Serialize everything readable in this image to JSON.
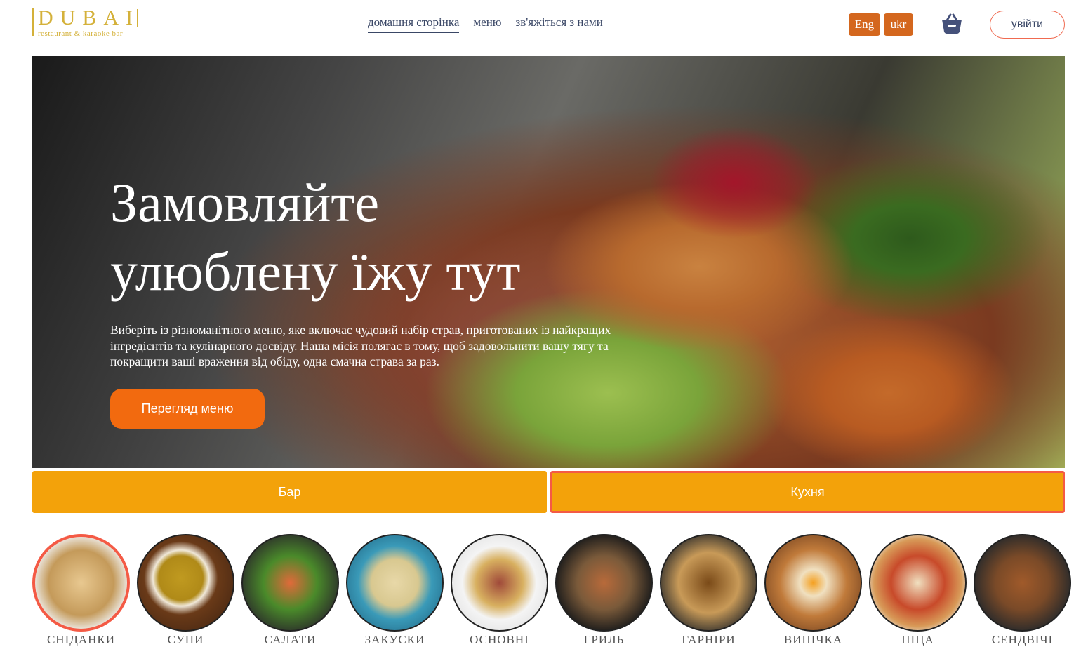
{
  "header": {
    "logo_title": "DUBAI",
    "logo_subtitle": "restaurant & karaoke bar",
    "nav": [
      "домашня сторінка",
      "меню",
      "зв'яжіться з нами"
    ],
    "lang": [
      "Eng",
      "ukr"
    ],
    "login": "увійти"
  },
  "hero": {
    "title_line1": "Замовляйте",
    "title_line2": "улюблену їжу тут",
    "text": "Виберіть із різноманітного меню, яке включає чудовий набір страв, приготованих із найкращих інгредієнтів та кулінарного досвіду. Наша місія полягає в тому, щоб задовольнити вашу тягу та покращити ваші враження від обіду, одна смачна страва за раз.",
    "button": "Перегляд меню"
  },
  "tabs": [
    "Бар",
    "Кухня"
  ],
  "categories": [
    "СНІДАНКИ",
    "СУПИ",
    "САЛАТИ",
    "ЗАКУСКИ",
    "ОСНОВНІ",
    "ГРИЛЬ",
    "ГАРНІРИ",
    "ВИПІЧКА",
    "ПІЦА",
    "СЕНДВІЧІ"
  ],
  "colors": {
    "accent": "#f26a0f",
    "tab": "#f3a20a",
    "lang": "#d4671e",
    "gold": "#d4b13a"
  }
}
